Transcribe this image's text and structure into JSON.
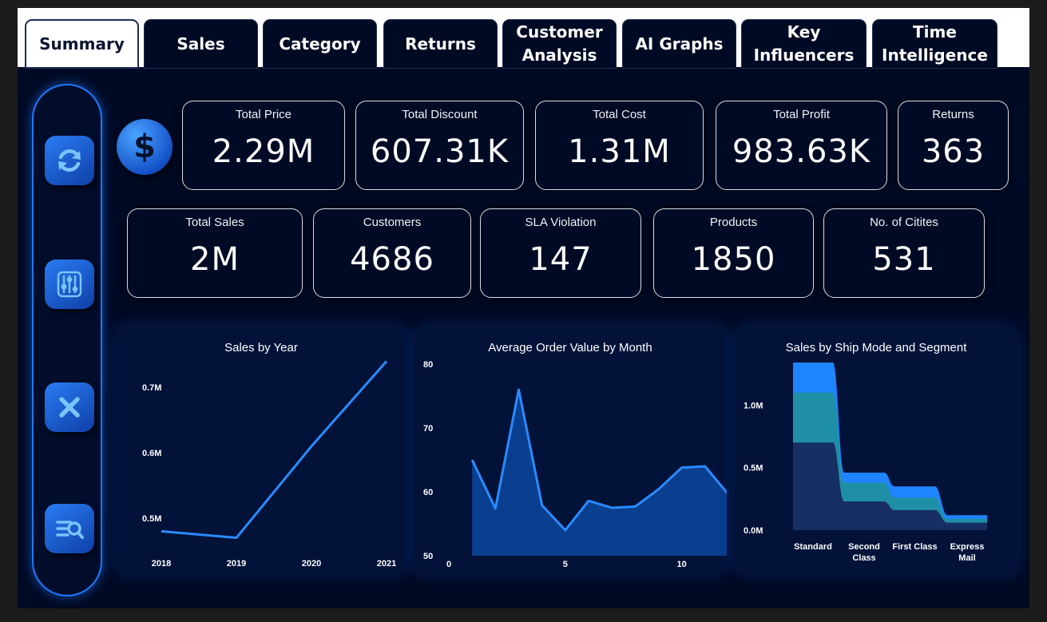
{
  "tabs": [
    {
      "label": "Summary",
      "active": true
    },
    {
      "label": "Sales",
      "active": false
    },
    {
      "label": "Category",
      "active": false
    },
    {
      "label": "Returns",
      "active": false
    },
    {
      "label": "Customer\nAnalysis",
      "active": false
    },
    {
      "label": "AI Graphs",
      "active": false
    },
    {
      "label": "Key\nInfluencers",
      "active": false
    },
    {
      "label": "Time\nIntelligence",
      "active": false
    }
  ],
  "sidebar": {
    "buttons": [
      {
        "icon": "refresh-icon"
      },
      {
        "icon": "sliders-icon"
      },
      {
        "icon": "close-icon"
      },
      {
        "icon": "search-list-icon"
      }
    ]
  },
  "badge": {
    "symbol": "$"
  },
  "kpis_row1": [
    {
      "label": "Total Price",
      "value": "2.29M"
    },
    {
      "label": "Total Discount",
      "value": "607.31K"
    },
    {
      "label": "Total Cost",
      "value": "1.31M"
    },
    {
      "label": "Total Profit",
      "value": "983.63K"
    },
    {
      "label": "Returns",
      "value": "363"
    }
  ],
  "kpis_row2": [
    {
      "label": "Total Sales",
      "value": "2M"
    },
    {
      "label": "Customers",
      "value": "4686"
    },
    {
      "label": "SLA Violation",
      "value": "147"
    },
    {
      "label": "Products",
      "value": "1850"
    },
    {
      "label": "No. of Citites",
      "value": "531"
    }
  ],
  "colors": {
    "accent": "#1f78ff",
    "background": "#000a24",
    "panel": "#021238",
    "line": "#2a8bff",
    "area_fill": "#0a3f8f",
    "segment_consumer": "#172f63",
    "segment_corporate": "#1f8fa6",
    "segment_home_office": "#1f84ff"
  },
  "chart_data": [
    {
      "type": "line",
      "title": "Sales by Year",
      "x": [
        "2018",
        "2019",
        "2020",
        "2021"
      ],
      "values": [
        0.48,
        0.47,
        0.61,
        0.74
      ],
      "y_ticks": [
        "0.5M",
        "0.6M",
        "0.7M"
      ],
      "y_tick_values": [
        0.5,
        0.6,
        0.7
      ],
      "ylim": [
        0.445,
        0.76
      ]
    },
    {
      "type": "area",
      "title": "Average Order Value by Month",
      "x": [
        1,
        2,
        3,
        4,
        5,
        6,
        7,
        8,
        9,
        10,
        11,
        12
      ],
      "values": [
        65,
        57.4,
        76,
        57.9,
        54,
        58.6,
        57.5,
        57.7,
        60.4,
        63.8,
        64,
        59.6
      ],
      "x_ticks": [
        "0",
        "5",
        "10"
      ],
      "x_tick_values": [
        0,
        5,
        10
      ],
      "y_ticks": [
        "50",
        "60",
        "70",
        "80"
      ],
      "y_tick_values": [
        50,
        60,
        70,
        80
      ],
      "xlim": [
        0,
        12
      ],
      "ylim": [
        50,
        80
      ]
    },
    {
      "type": "area",
      "title": "Sales by Ship Mode and Segment",
      "categories": [
        "Standard",
        "Second\nClass",
        "First Class",
        "Express\nMail"
      ],
      "series": [
        {
          "values": [
            0.7,
            0.23,
            0.16,
            0.06
          ]
        },
        {
          "values": [
            0.4,
            0.15,
            0.1,
            0.03
          ]
        },
        {
          "values": [
            0.24,
            0.08,
            0.09,
            0.03
          ]
        }
      ],
      "y_ticks": [
        "0.0M",
        "0.5M",
        "1.0M"
      ],
      "y_tick_values": [
        0,
        0.5,
        1.0
      ],
      "ylim": [
        0,
        1.34
      ]
    }
  ]
}
